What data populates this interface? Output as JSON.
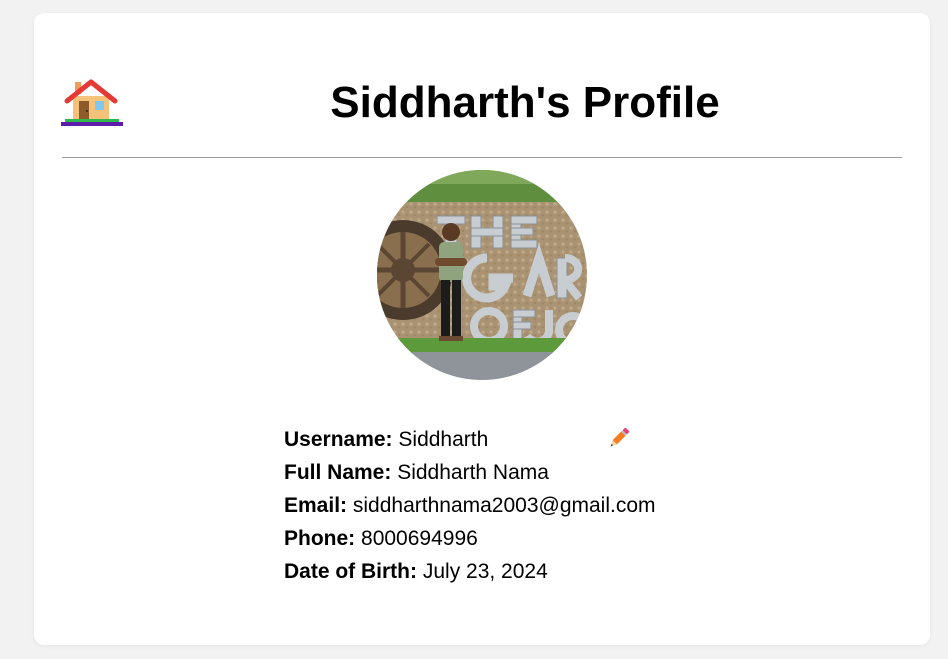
{
  "header": {
    "home_icon": "house-icon",
    "title": "Siddharth's Profile"
  },
  "profile": {
    "avatar_alt": "Profile picture",
    "edit_icon": "pencil-icon",
    "fields": [
      {
        "label": "Username:",
        "value": "Siddharth"
      },
      {
        "label": "Full Name:",
        "value": "Siddharth Nama"
      },
      {
        "label": "Email:",
        "value": "siddharthnama2003@gmail.com"
      },
      {
        "label": "Phone:",
        "value": "8000694996"
      },
      {
        "label": "Date of Birth:",
        "value": "July 23, 2024"
      }
    ]
  },
  "colors": {
    "background": "#f2f2f2",
    "card": "#ffffff",
    "divider": "#9a9a9a",
    "text": "#000000",
    "home_roof": "#e53935",
    "home_wall": "#f5c27a",
    "home_base": "#5e1aa8",
    "pencil": "#f47b20"
  }
}
